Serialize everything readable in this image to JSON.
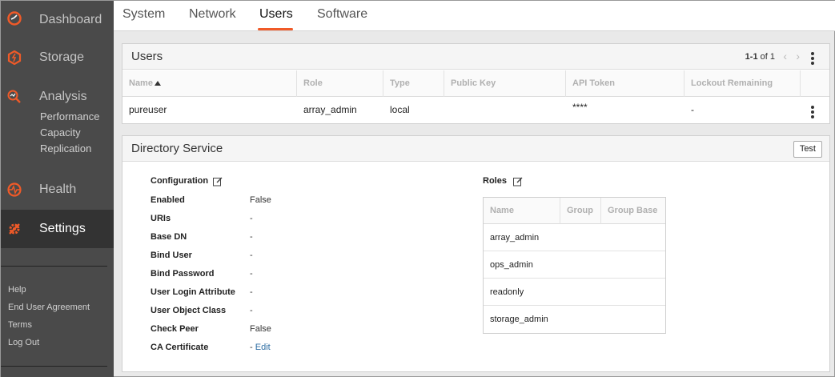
{
  "sidebar": {
    "nav": [
      {
        "label": "Dashboard",
        "icon": "dashboard-icon"
      },
      {
        "label": "Storage",
        "icon": "storage-icon"
      },
      {
        "label": "Analysis",
        "icon": "analysis-icon"
      },
      {
        "label": "Health",
        "icon": "health-icon"
      },
      {
        "label": "Settings",
        "icon": "settings-icon"
      }
    ],
    "analysis_sub": [
      "Performance",
      "Capacity",
      "Replication"
    ],
    "footer": [
      "Help",
      "End User Agreement",
      "Terms",
      "Log Out"
    ]
  },
  "tabs": [
    "System",
    "Network",
    "Users",
    "Software"
  ],
  "active_tab": "Users",
  "accent_color": "#f05a28",
  "users_panel": {
    "title": "Users",
    "pager_range": "1-1",
    "pager_total": "of 1",
    "columns": [
      "Name",
      "Role",
      "Type",
      "Public Key",
      "API Token",
      "Lockout Remaining"
    ],
    "rows": [
      {
        "name": "pureuser",
        "role": "array_admin",
        "type": "local",
        "public_key": "",
        "api_token": "****",
        "lockout": "-"
      }
    ]
  },
  "directory_panel": {
    "title": "Directory Service",
    "test_label": "Test",
    "configuration": {
      "title": "Configuration",
      "items": [
        {
          "key": "Enabled",
          "value": "False"
        },
        {
          "key": "URIs",
          "value": "-"
        },
        {
          "key": "Base DN",
          "value": "-"
        },
        {
          "key": "Bind User",
          "value": "-"
        },
        {
          "key": "Bind Password",
          "value": "-"
        },
        {
          "key": "User Login Attribute",
          "value": "-"
        },
        {
          "key": "User Object Class",
          "value": "-"
        },
        {
          "key": "Check Peer",
          "value": "False"
        },
        {
          "key": "CA Certificate",
          "value": "- ",
          "link": "Edit"
        }
      ]
    },
    "roles": {
      "title": "Roles",
      "columns": [
        "Name",
        "Group",
        "Group Base"
      ],
      "rows": [
        "array_admin",
        "ops_admin",
        "readonly",
        "storage_admin"
      ]
    }
  }
}
